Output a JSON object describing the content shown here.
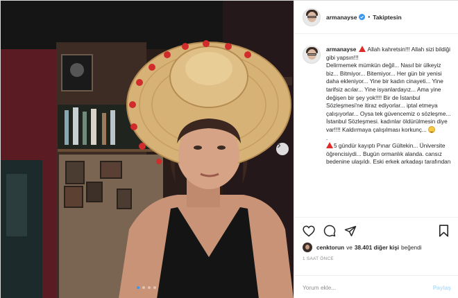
{
  "post": {
    "author": {
      "username": "armanayse",
      "verified": true,
      "follow_separator": "•",
      "follow_label": "Takiptesin"
    },
    "caption": {
      "username": "armanayse",
      "lines": [
        "Allah kahretsin!!! Allah sizi bildiği gibi yapsın!!!",
        "Delirmemek mümkün değil... Nasıl bir ülkeyiz biz... Bitmiyor... Bitemiyor... Her gün bir yenisi daha ekleniyor... Yine bir kadın cinayeti... Yine tarifsiz acılar... Yine isyanlardayız... Ama yine değişen bir şey yok!!!! Bir de İstanbul Sözleşmesi'ne itiraz ediyorlar... iptal etmeya çalışıyorlar... Oysa tek güvencemiz o sözleşme... İstanbul Sözleşmesi. kadınlar öldürülmesin diye var!!!! Kaldırmaya çalışılması korkunç...",
        ".",
        "5 gündür kayıptı Pınar Gültekin... Üniversite öğrencisiydi... Bugün ormanlık alanda. cansız bedenine ulaşıldı. Eski erkek arkadaşı tarafından"
      ],
      "warning_icon": "warning-triangle-icon",
      "emoji_icon": "smiling-face-icon"
    },
    "actions": {
      "like_icon": "heart-icon",
      "comment_icon": "comment-bubble-icon",
      "share_icon": "paper-plane-icon",
      "save_icon": "bookmark-icon"
    },
    "likes": {
      "liker": "cenktorun",
      "connector": "ve",
      "others": "38.401 diğer kişi",
      "suffix": "beğendi"
    },
    "timestamp": "1 SAAT ÖNCE",
    "comment": {
      "placeholder": "Yorum ekle...",
      "post_label": "Paylaş"
    },
    "carousel": {
      "slide_count": 4,
      "active_index": 0,
      "next_icon": "chevron-right-icon"
    },
    "colors": {
      "accent_blue": "#3897f0",
      "disabled_blue": "#b2dffc",
      "warning_red": "#e02a2a",
      "border": "#dbdbdb",
      "muted": "#8e8e8e"
    }
  }
}
